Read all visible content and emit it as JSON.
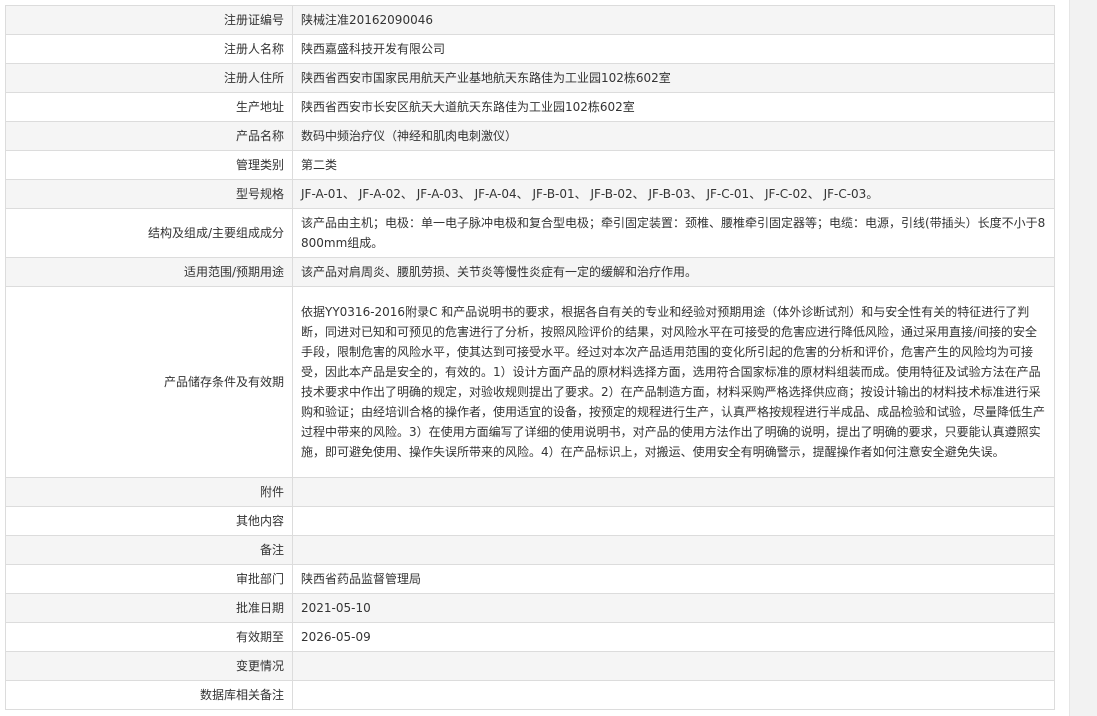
{
  "rows": [
    {
      "label": "注册证编号",
      "value": "陕械注准20162090046"
    },
    {
      "label": "注册人名称",
      "value": "陕西嘉盛科技开发有限公司"
    },
    {
      "label": "注册人住所",
      "value": "陕西省西安市国家民用航天产业基地航天东路佳为工业园102栋602室"
    },
    {
      "label": "生产地址",
      "value": "陕西省西安市长安区航天大道航天东路佳为工业园102栋602室"
    },
    {
      "label": "产品名称",
      "value": "数码中频治疗仪（神经和肌肉电刺激仪）"
    },
    {
      "label": "管理类别",
      "value": "第二类"
    },
    {
      "label": "型号规格",
      "value": "JF-A-01、 JF-A-02、 JF-A-03、 JF-A-04、 JF-B-01、 JF-B-02、 JF-B-03、 JF-C-01、 JF-C-02、 JF-C-03。"
    },
    {
      "label": "结构及组成/主要组成成分",
      "value": "该产品由主机；电极：单一电子脉冲电极和复合型电极；牵引固定装置：颈椎、腰椎牵引固定器等；电缆：电源，引线(带插头）长度不小于8800mm组成。"
    },
    {
      "label": "适用范围/预期用途",
      "value": "该产品对肩周炎、腰肌劳损、关节炎等慢性炎症有一定的缓解和治疗作用。"
    },
    {
      "label": "产品储存条件及有效期",
      "value": "依据YY0316-2016附录C 和产品说明书的要求，根据各自有关的专业和经验对预期用途（体外诊断试剂）和与安全性有关的特征进行了判断，同进对已知和可预见的危害进行了分析，按照风险评价的结果，对风险水平在可接受的危害应进行降低风险，通过采用直接/间接的安全手段，限制危害的风险水平，使其达到可接受水平。经过对本次产品适用范围的变化所引起的危害的分析和评价，危害产生的风险均为可接受，因此本产品是安全的，有效的。1）设计方面产品的原材料选择方面，选用符合国家标准的原材料组装而成。使用特征及试验方法在产品技术要求中作出了明确的规定，对验收规则提出了要求。2）在产品制造方面，材料采购严格选择供应商；按设计输出的材料技术标准进行采购和验证；由经培训合格的操作者，使用适宜的设备，按预定的规程进行生产，认真严格按规程进行半成品、成品检验和试验，尽量降低生产过程中带来的风险。3）在使用方面编写了详细的使用说明书，对产品的使用方法作出了明确的说明，提出了明确的要求，只要能认真遵照实施，即可避免使用、操作失误所带来的风险。4）在产品标识上，对搬运、使用安全有明确警示，提醒操作者如何注意安全避免失误。"
    },
    {
      "label": "附件",
      "value": ""
    },
    {
      "label": "其他内容",
      "value": ""
    },
    {
      "label": "备注",
      "value": ""
    },
    {
      "label": "审批部门",
      "value": "陕西省药品监督管理局"
    },
    {
      "label": "批准日期",
      "value": "2021-05-10"
    },
    {
      "label": "有效期至",
      "value": "2026-05-09"
    },
    {
      "label": "变更情况",
      "value": ""
    },
    {
      "label": "数据库相关备注",
      "value": ""
    }
  ]
}
